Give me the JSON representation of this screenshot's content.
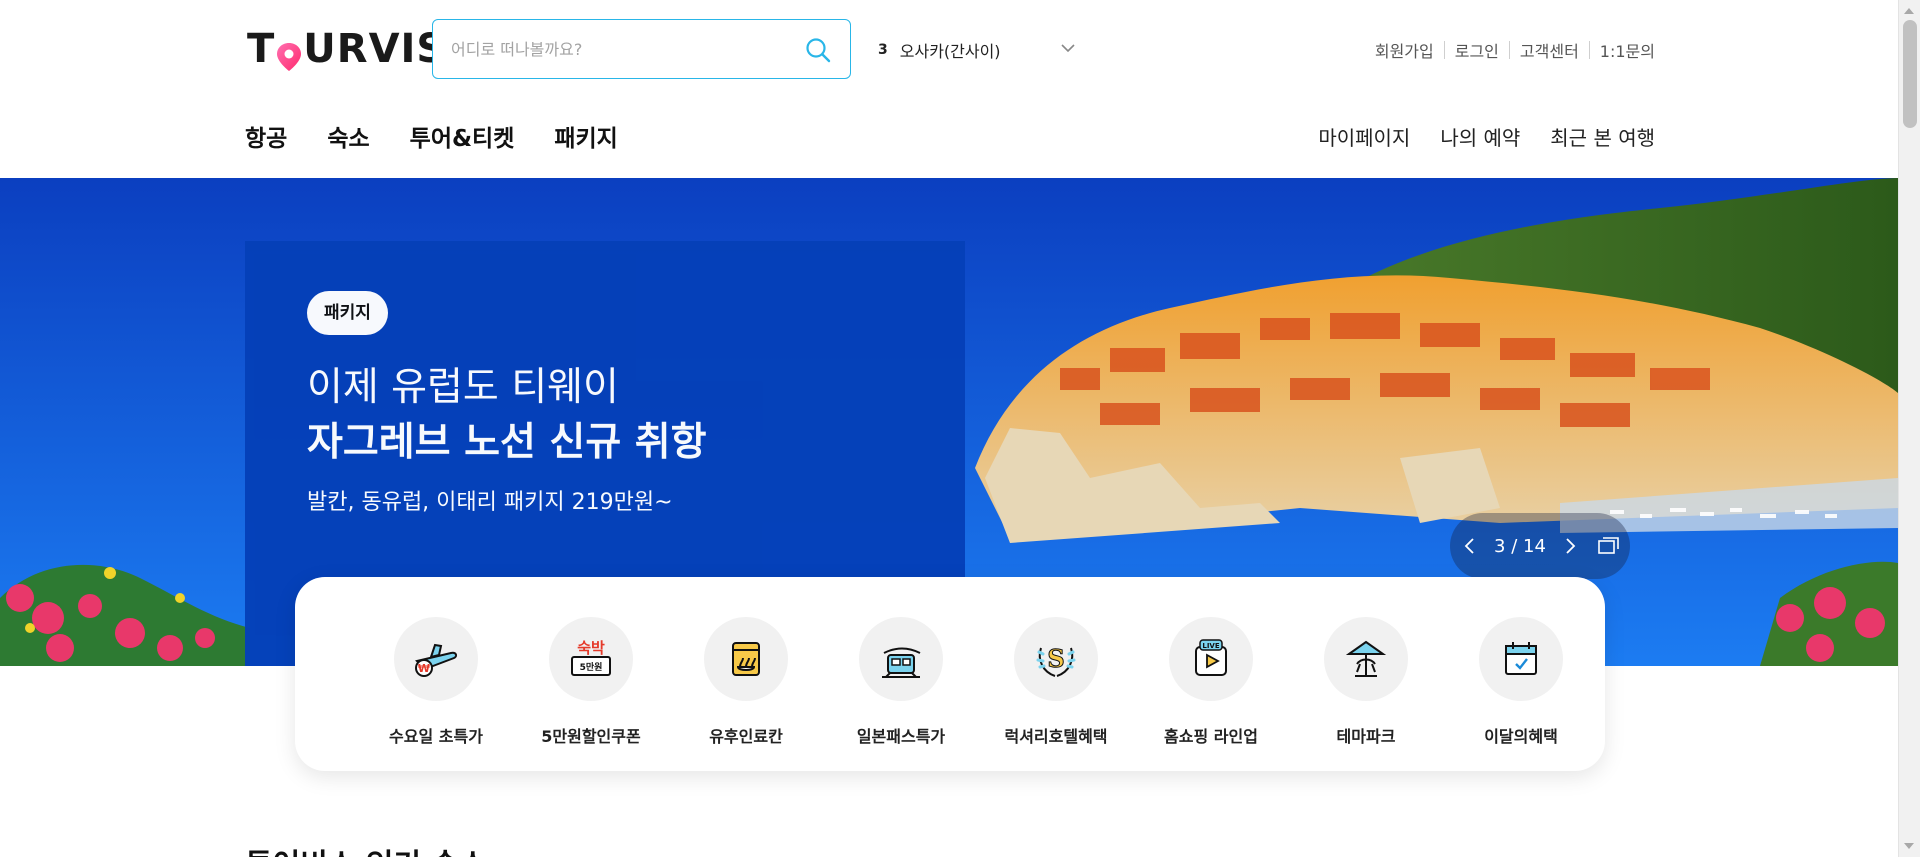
{
  "header": {
    "logo_text_left": "T",
    "logo_text_right": "URVIS",
    "search": {
      "placeholder": "어디로 떠나볼까요?"
    },
    "ticker": {
      "rank": "3",
      "keyword": "오사카(간사이)"
    },
    "util_links": [
      "회원가입",
      "로그인",
      "고객센터",
      "1:1문의"
    ]
  },
  "nav": {
    "main": [
      "항공",
      "숙소",
      "투어&티켓",
      "패키지"
    ],
    "right": [
      "마이페이지",
      "나의 예약",
      "최근 본 여행"
    ]
  },
  "hero": {
    "badge": "패키지",
    "line1": "이제 유럽도 티웨이",
    "line2": "자그레브 노선 신규 취항",
    "sub": "발칸, 동유럽, 이태리 패키지 219만원~",
    "pager": {
      "current": "3",
      "total": "14",
      "separator": "/"
    }
  },
  "quick_menu": [
    {
      "label": "수요일 초특가",
      "icon": "airplane-price-icon"
    },
    {
      "label": "5만원할인쿠폰",
      "icon": "coupon-icon",
      "icon_text_top": "숙박",
      "icon_text_bottom": "5만원"
    },
    {
      "label": "유후인료칸",
      "icon": "onsen-icon"
    },
    {
      "label": "일본패스특가",
      "icon": "train-pass-icon"
    },
    {
      "label": "럭셔리호텔혜택",
      "icon": "luxury-emblem-icon"
    },
    {
      "label": "홈쇼핑 라인업",
      "icon": "live-play-icon",
      "icon_text": "LIVE"
    },
    {
      "label": "테마파크",
      "icon": "theme-park-icon"
    },
    {
      "label": "이달의혜택",
      "icon": "calendar-check-icon"
    }
  ],
  "section": {
    "title": "투어비스 인기 숙소"
  },
  "colors": {
    "accent": "#29b6e8",
    "hero_panel": "#0540b8",
    "logo_pin": "#ff3e8a"
  }
}
